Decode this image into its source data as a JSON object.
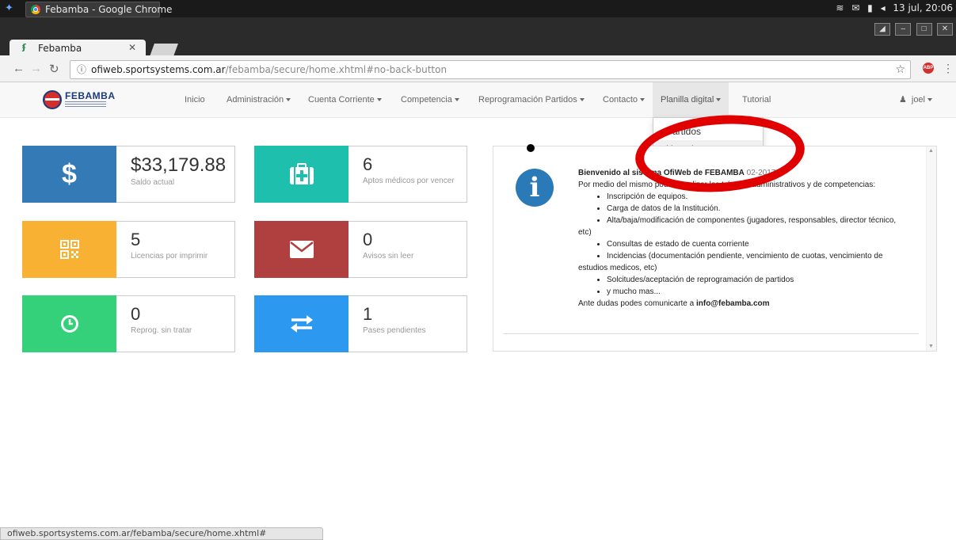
{
  "os": {
    "task_title": "Febamba - Google Chrome",
    "clock": "13 jul, 20:06"
  },
  "browser": {
    "tab_title": "Febamba",
    "url_host": "ofiweb.sportsystems.com.ar",
    "url_path": "/febamba/secure/home.xhtml#no-back-button",
    "status_url": "ofiweb.sportsystems.com.ar/febamba/secure/home.xhtml#"
  },
  "navbar": {
    "brand": "FEBAMBA",
    "items": [
      "Inicio",
      "Administración",
      "Cuenta Corriente",
      "Competencia",
      "Reprogramación Partidos",
      "Contacto",
      "Planilla digital",
      "Tutorial"
    ],
    "user": "joel"
  },
  "dropdown": {
    "items": [
      "Partidos",
      "Usuarios"
    ]
  },
  "tiles": [
    {
      "value": "$33,179.88",
      "label": "Saldo actual",
      "color": "#337ab7",
      "icon": "dollar-icon"
    },
    {
      "value": "6",
      "label": "Aptos médicos por vencer",
      "color": "#1fbfae",
      "icon": "medkit-icon"
    },
    {
      "value": "5",
      "label": "Licencias por imprimir",
      "color": "#f8b133",
      "icon": "qrcode-icon"
    },
    {
      "value": "0",
      "label": "Avisos sin leer",
      "color": "#b0403f",
      "icon": "envelope-icon"
    },
    {
      "value": "0",
      "label": "Reprog. sin tratar",
      "color": "#34d17a",
      "icon": "clock-icon"
    },
    {
      "value": "1",
      "label": "Pases pendientes",
      "color": "#2c98f0",
      "icon": "exchange-icon"
    }
  ],
  "welcome": {
    "title_bold": "Bienvenido al sistema OfiWeb de FEBAMBA",
    "title_date": "02-2017",
    "intro": "Por medio del mismo podrás realizar los trámites administrativos y de competencias:",
    "bullets_a": [
      "Inscripción de equipos.",
      "Carga de datos de la Institución."
    ],
    "bullet_alta": "Alta/baja/modificación de componentes (jugadores, responsables, director técnico,",
    "bullet_alta_cont": "etc)",
    "bullet_consultas": "Consultas de estado de cuenta corriente",
    "bullet_incid": "Incidencias (documentación pendiente, vencimiento de cuotas, vencimiento de",
    "bullet_incid_cont": "estudios medicos, etc)",
    "bullets_b": [
      "Solcitudes/aceptación de reprogramación de partidos",
      "y mucho mas..."
    ],
    "contact_prefix": "Ante dudas podes comunicarte a ",
    "contact_email": "info@febamba.com"
  }
}
